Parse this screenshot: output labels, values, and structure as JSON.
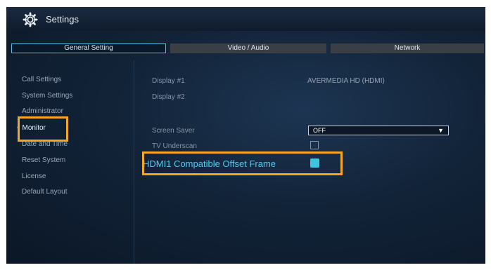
{
  "window": {
    "title": "Settings",
    "icon": "gear-icon"
  },
  "tabs": [
    {
      "label": "General Setting",
      "active": true
    },
    {
      "label": "Video / Audio",
      "active": false
    },
    {
      "label": "Network",
      "active": false
    }
  ],
  "sidebar": {
    "items": [
      {
        "label": "Call Settings"
      },
      {
        "label": "System Settings"
      },
      {
        "label": "Administrator"
      },
      {
        "label": "Monitor",
        "active": true,
        "bullet": "•"
      },
      {
        "label": "Date and Time"
      },
      {
        "label": "Reset System"
      },
      {
        "label": "License"
      },
      {
        "label": "Default Layout"
      }
    ]
  },
  "main": {
    "display1": {
      "label": "Display #1",
      "value": "AVERMEDIA HD (HDMI)"
    },
    "display2": {
      "label": "Display #2"
    },
    "screen_saver": {
      "label": "Screen Saver",
      "value": "OFF",
      "arrow": "▼"
    },
    "tv_underscan": {
      "label": "TV Underscan",
      "checked": false
    },
    "hdmi_offset": {
      "label": "HDMI1 Compatible Offset Frame",
      "checked": true
    }
  },
  "colors": {
    "accent": "#4cc9f2",
    "highlight": "#f5a623",
    "checkbox_on": "#3ec3e0"
  }
}
